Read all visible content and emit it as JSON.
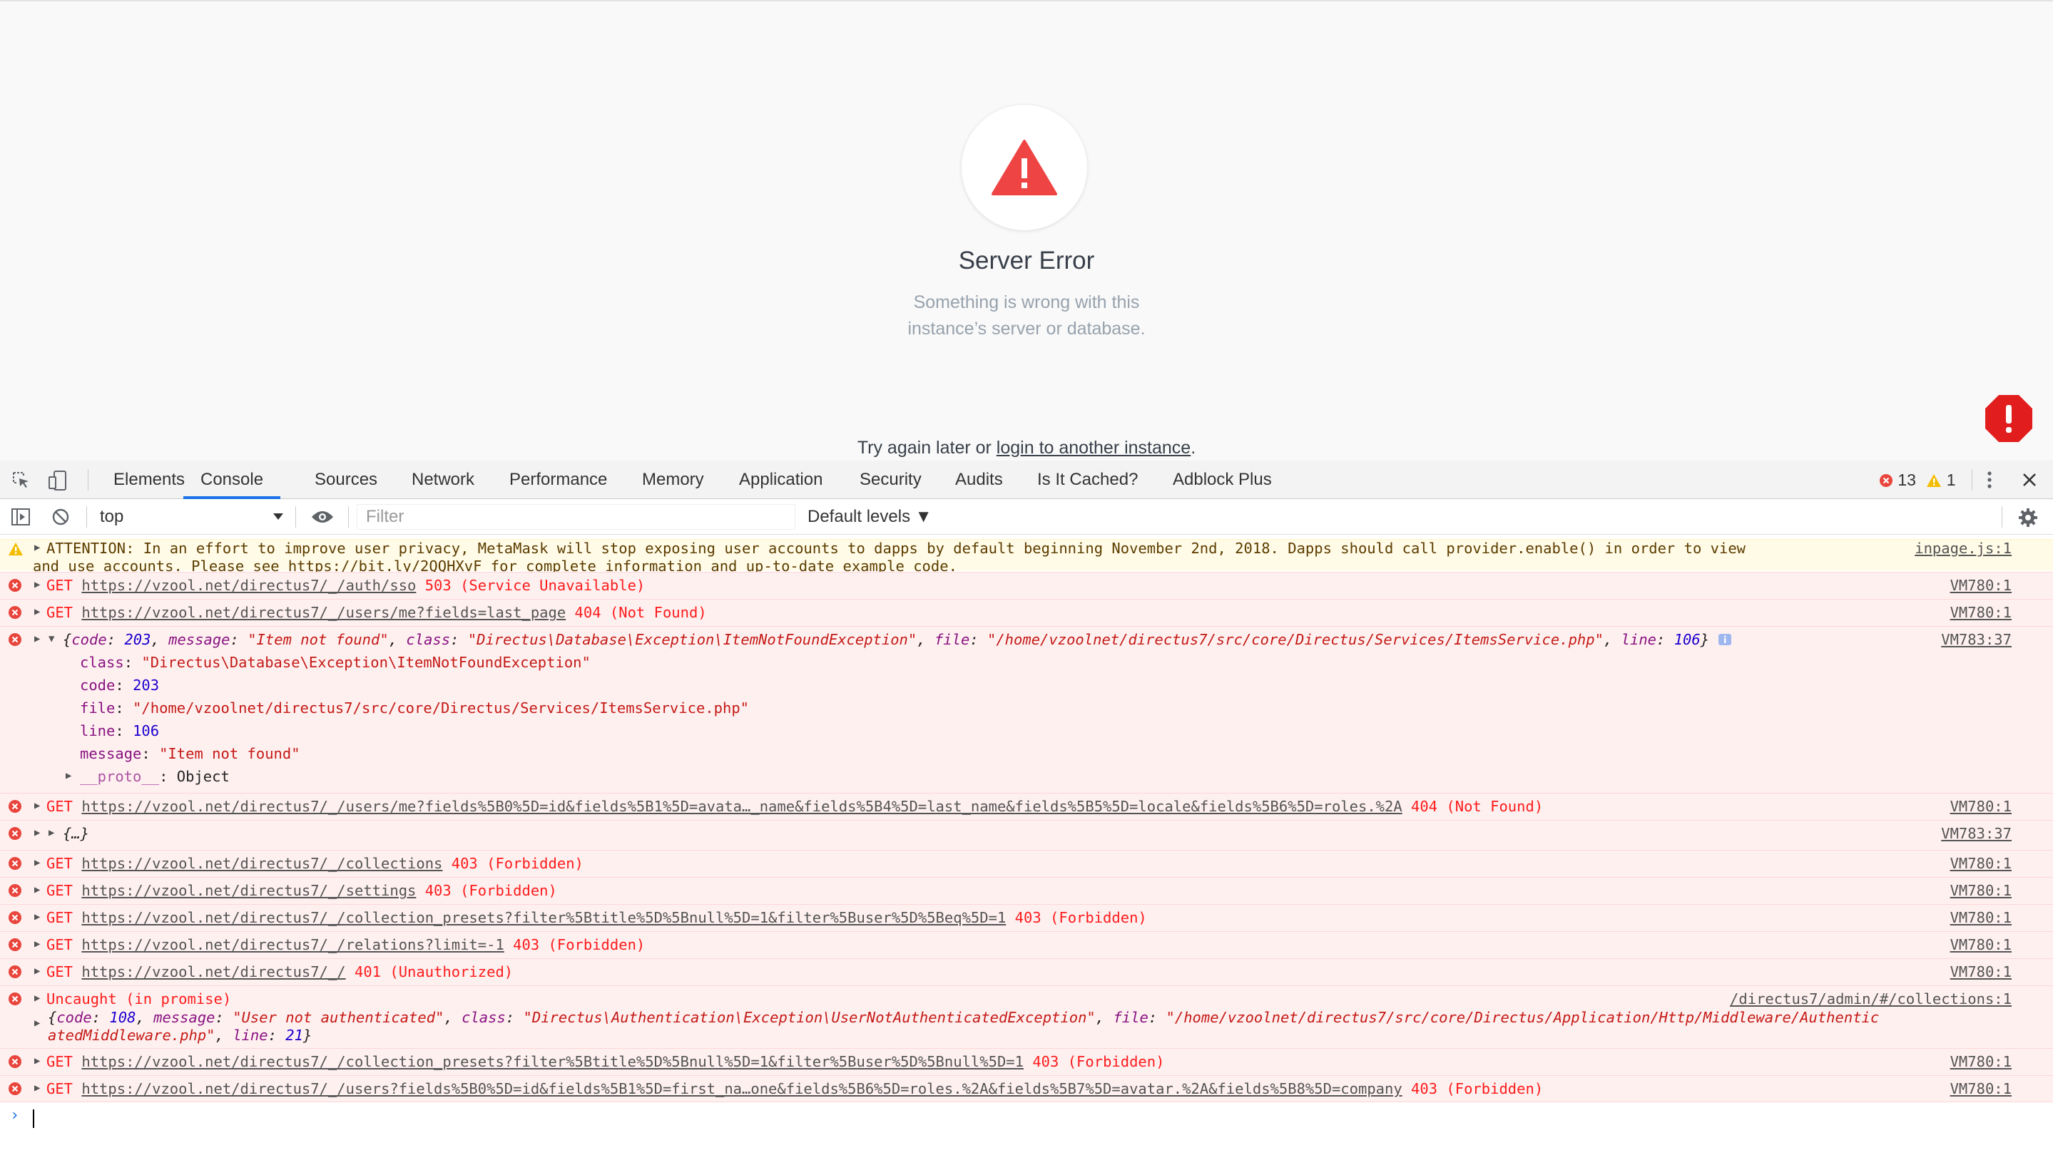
{
  "page": {
    "error_title": "Server Error",
    "error_message": "Something is wrong with this instance’s server or database.",
    "try_again_prefix": "Try again later or ",
    "try_again_link": "login to another instance",
    "try_again_suffix": "."
  },
  "devtools": {
    "tabs": [
      "Elements",
      "Console",
      "Sources",
      "Network",
      "Performance",
      "Memory",
      "Application",
      "Security",
      "Audits",
      "Is It Cached?",
      "Adblock Plus"
    ],
    "active_tab": "Console",
    "error_count": "13",
    "warning_count": "1",
    "context": "top",
    "filter_placeholder": "Filter",
    "levels": "Default levels ▼"
  },
  "console": {
    "warning": {
      "line1": "ATTENTION: In an effort to improve user privacy, MetaMask will stop exposing user accounts to dapps by default beginning November 2nd, 2018. Dapps should call provider.enable() in order to view",
      "line2_prefix": "and use accounts. Please see ",
      "line2_link": "https://bit.ly/2QQHXvF",
      "line2_suffix": " for complete information and up-to-date example code.",
      "source": "inpage.js:1"
    },
    "rows": [
      {
        "method": "GET",
        "url": "https://vzool.net/directus7/_/auth/sso",
        "status": "503 (Service Unavailable)",
        "source": "VM780:1"
      },
      {
        "method": "GET",
        "url": "https://vzool.net/directus7/_/users/me?fields=last_page",
        "status": "404 (Not Found)",
        "source": "VM780:1"
      },
      {
        "method": "GET",
        "url": "https://vzool.net/directus7/_/users/me?fields%5B0%5D=id&fields%5B1%5D=avata…_name&fields%5B4%5D=last_name&fields%5B5%5D=locale&fields%5B6%5D=roles.%2A",
        "status": "404 (Not Found)",
        "source": "VM780:1"
      },
      {
        "method": "GET",
        "url": "https://vzool.net/directus7/_/collections",
        "status": "403 (Forbidden)",
        "source": "VM780:1"
      },
      {
        "method": "GET",
        "url": "https://vzool.net/directus7/_/settings",
        "status": "403 (Forbidden)",
        "source": "VM780:1"
      },
      {
        "method": "GET",
        "url": "https://vzool.net/directus7/_/collection_presets?filter%5Btitle%5D%5Bnull%5D=1&filter%5Buser%5D%5Beq%5D=1",
        "status": "403 (Forbidden)",
        "source": "VM780:1"
      },
      {
        "method": "GET",
        "url": "https://vzool.net/directus7/_/relations?limit=-1",
        "status": "403 (Forbidden)",
        "source": "VM780:1"
      },
      {
        "method": "GET",
        "url": "https://vzool.net/directus7/_/",
        "status": "401 (Unauthorized)",
        "source": "VM780:1"
      },
      {
        "method": "GET",
        "url": "https://vzool.net/directus7/_/collection_presets?filter%5Btitle%5D%5Bnull%5D=1&filter%5Buser%5D%5Bnull%5D=1",
        "status": "403 (Forbidden)",
        "source": "VM780:1"
      },
      {
        "method": "GET",
        "url": "https://vzool.net/directus7/_/users?fields%5B0%5D=id&fields%5B1%5D=first_na…one&fields%5B6%5D=roles.%2A&fields%5B7%5D=avatar.%2A&fields%5B8%5D=company",
        "status": "403 (Forbidden)",
        "source": "VM780:1"
      }
    ],
    "object_error": {
      "source": "VM783:37",
      "code": "203",
      "message": "\"Item not found\"",
      "class": "\"Directus\\Database\\Exception\\ItemNotFoundException\"",
      "file": "\"/home/vzoolnet/directus7/src/core/Directus/Services/ItemsService.php\"",
      "line": "106",
      "proto_label": "__proto__",
      "proto_value": "Object"
    },
    "collapsed_object": {
      "text": "{…}",
      "source": "VM783:37"
    },
    "uncaught": {
      "title": "Uncaught (in promise)",
      "source": "/directus7/admin/#/collections:1",
      "code": "108",
      "message": "\"User not authenticated\"",
      "class": "\"Directus\\Authentication\\Exception\\UserNotAuthenticatedException\"",
      "file_part1": "\"/home/vzoolnet/directus7/src/core/Directus/Application/Http/Middleware/Authentic",
      "file_part2": "atedMiddleware.php\"",
      "line": "21"
    }
  },
  "colors": {
    "accent": "#1a73e8",
    "error_text": "#fe1c1c",
    "error_bg": "#fff0f0",
    "warning_bg": "#fffbe6",
    "warning_icon": "#f4bd00",
    "server_error_icon": "#ef4444"
  }
}
